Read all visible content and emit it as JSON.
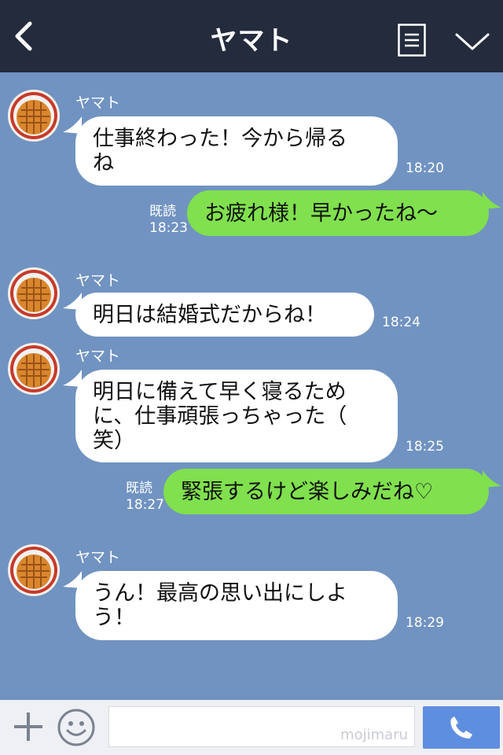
{
  "header": {
    "title": "ヤマト"
  },
  "messages": [
    {
      "side": "in",
      "sender": "ヤマト",
      "text": "仕事終わった！今から帰る\nね",
      "time": "18:20"
    },
    {
      "side": "out",
      "text": "お疲れ様！早かったね〜",
      "read": "既読",
      "time": "18:23"
    },
    {
      "side": "in",
      "sender": "ヤマト",
      "text": "明日は結婚式だからね！",
      "time": "18:24"
    },
    {
      "side": "in",
      "sender": "ヤマト",
      "text": "明日に備えて早く寝るため\nに、仕事頑張っちゃった（\n笑）",
      "time": "18:25"
    },
    {
      "side": "out",
      "text": "緊張するけど楽しみだね♡",
      "read": "既読",
      "time": "18:27"
    },
    {
      "side": "in",
      "sender": "ヤマト",
      "text": "うん！最高の思い出にしよ\nう！",
      "time": "18:29"
    }
  ],
  "inputbar": {
    "watermark": "mojimaru"
  },
  "colors": {
    "header_bg": "#232b3d",
    "chat_bg": "#7193c1",
    "incoming_bubble": "#ffffff",
    "outgoing_bubble": "#80e04e",
    "send_button": "#5e8ee0"
  },
  "icons": [
    "back-arrow-icon",
    "menu-icon",
    "chevron-down-icon",
    "plus-icon",
    "smiley-icon",
    "phone-icon"
  ]
}
